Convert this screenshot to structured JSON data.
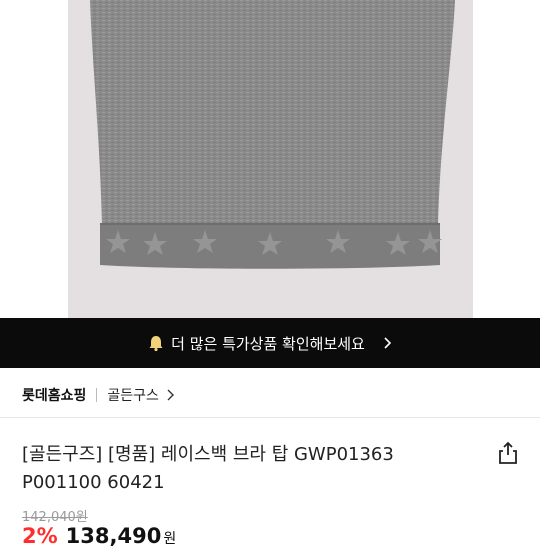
{
  "promo": {
    "text": "더 많은 특가상품 확인해보세요"
  },
  "breadcrumb": {
    "store": "롯데홈쇼핑",
    "brand": "골든구스"
  },
  "product": {
    "title_line1": "[골든구즈] [명품] 레이스백 브라 탑 GWP01363",
    "title_line2": "P001100 60421",
    "original_price": "142,040원",
    "discount": "2%",
    "price": "138,490",
    "currency": "원"
  },
  "colors": {
    "banner_bg": "#0b0b0b",
    "discount": "#ff2d2d",
    "fabric": "#8a8a8a",
    "backdrop": "#e4e0e1"
  },
  "icons": [
    "bell-icon",
    "chevron-right-icon",
    "share-icon",
    "star-icon"
  ]
}
